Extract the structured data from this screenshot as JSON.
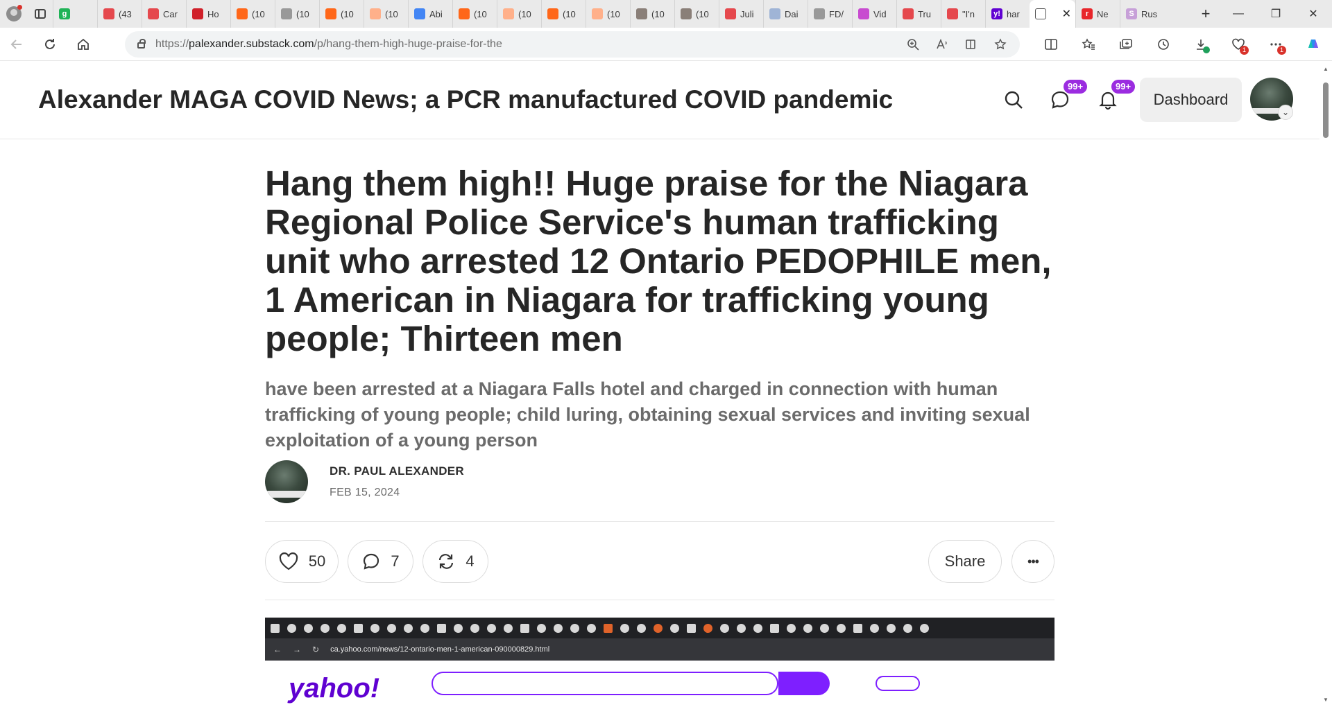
{
  "browser": {
    "tabs": [
      {
        "title": "",
        "fav": "g",
        "color": "#20b357"
      },
      {
        "title": "(43",
        "fav": "",
        "color": "#e5484d"
      },
      {
        "title": "Car",
        "fav": "",
        "color": "#e5484d"
      },
      {
        "title": "Ho",
        "fav": "",
        "color": "#d0202a"
      },
      {
        "title": "(10",
        "fav": "",
        "color": "#ff6719"
      },
      {
        "title": "(10",
        "fav": "",
        "color": "#999999"
      },
      {
        "title": "(10",
        "fav": "",
        "color": "#ff6719"
      },
      {
        "title": "(10",
        "fav": "",
        "color": "#ffb08a"
      },
      {
        "title": "Abi",
        "fav": "",
        "color": "#4285f4"
      },
      {
        "title": "(10",
        "fav": "",
        "color": "#ff6719"
      },
      {
        "title": "(10",
        "fav": "",
        "color": "#ffb08a"
      },
      {
        "title": "(10",
        "fav": "",
        "color": "#ff6719"
      },
      {
        "title": "(10",
        "fav": "",
        "color": "#ffb08a"
      },
      {
        "title": "(10",
        "fav": "",
        "color": "#8a7f78"
      },
      {
        "title": "(10",
        "fav": "",
        "color": "#8a7f78"
      },
      {
        "title": "Juli",
        "fav": "",
        "color": "#e5484d"
      },
      {
        "title": "Dai",
        "fav": "",
        "color": "#9fb4d6"
      },
      {
        "title": "FD/",
        "fav": "",
        "color": "#999999"
      },
      {
        "title": "Vid",
        "fav": "",
        "color": "#c84bd0"
      },
      {
        "title": "Tru",
        "fav": "",
        "color": "#e5484d"
      },
      {
        "title": "\"I'n",
        "fav": "",
        "color": "#e5484d"
      },
      {
        "title": "har",
        "fav": "y!",
        "color": "#6001d2"
      }
    ],
    "active_tab": {
      "title": "",
      "close": "✕"
    },
    "tabs_after": [
      {
        "title": "Ne",
        "fav": "r",
        "color": "#e8262b"
      },
      {
        "title": "Rus",
        "fav": "S",
        "color": "#c7a0d8"
      }
    ],
    "new_tab": "+",
    "window_controls": {
      "minimize": "—",
      "restore": "❐",
      "close": "✕"
    },
    "url": {
      "scheme": "https://",
      "host": "palexander.substack.com",
      "path": "/p/hang-them-high-huge-praise-for-the"
    }
  },
  "site": {
    "title": "Alexander MAGA COVID News; a PCR manufactured COVID pandemic",
    "chat_badge": "99+",
    "notif_badge": "99+",
    "dashboard": "Dashboard",
    "chevron": "⌄"
  },
  "post": {
    "title": "Hang them high!! Huge praise for the Niagara Regional Police Service's human trafficking unit who arrested 12 Ontario PEDOPHILE men, 1 American in Niagara for trafficking young people; Thirteen men",
    "subtitle": "have been arrested at a Niagara Falls hotel and charged in connection with human trafficking of young people; child luring, obtaining sexual services and inviting sexual exploitation of a young person",
    "author": "DR. PAUL ALEXANDER",
    "date": "FEB 15, 2024",
    "likes": "50",
    "comments": "7",
    "restacks": "4",
    "share": "Share",
    "more": "•••"
  },
  "embed": {
    "url": "ca.yahoo.com/news/12-ontario-men-1-american-090000829.html",
    "logo": "yahoo!"
  }
}
